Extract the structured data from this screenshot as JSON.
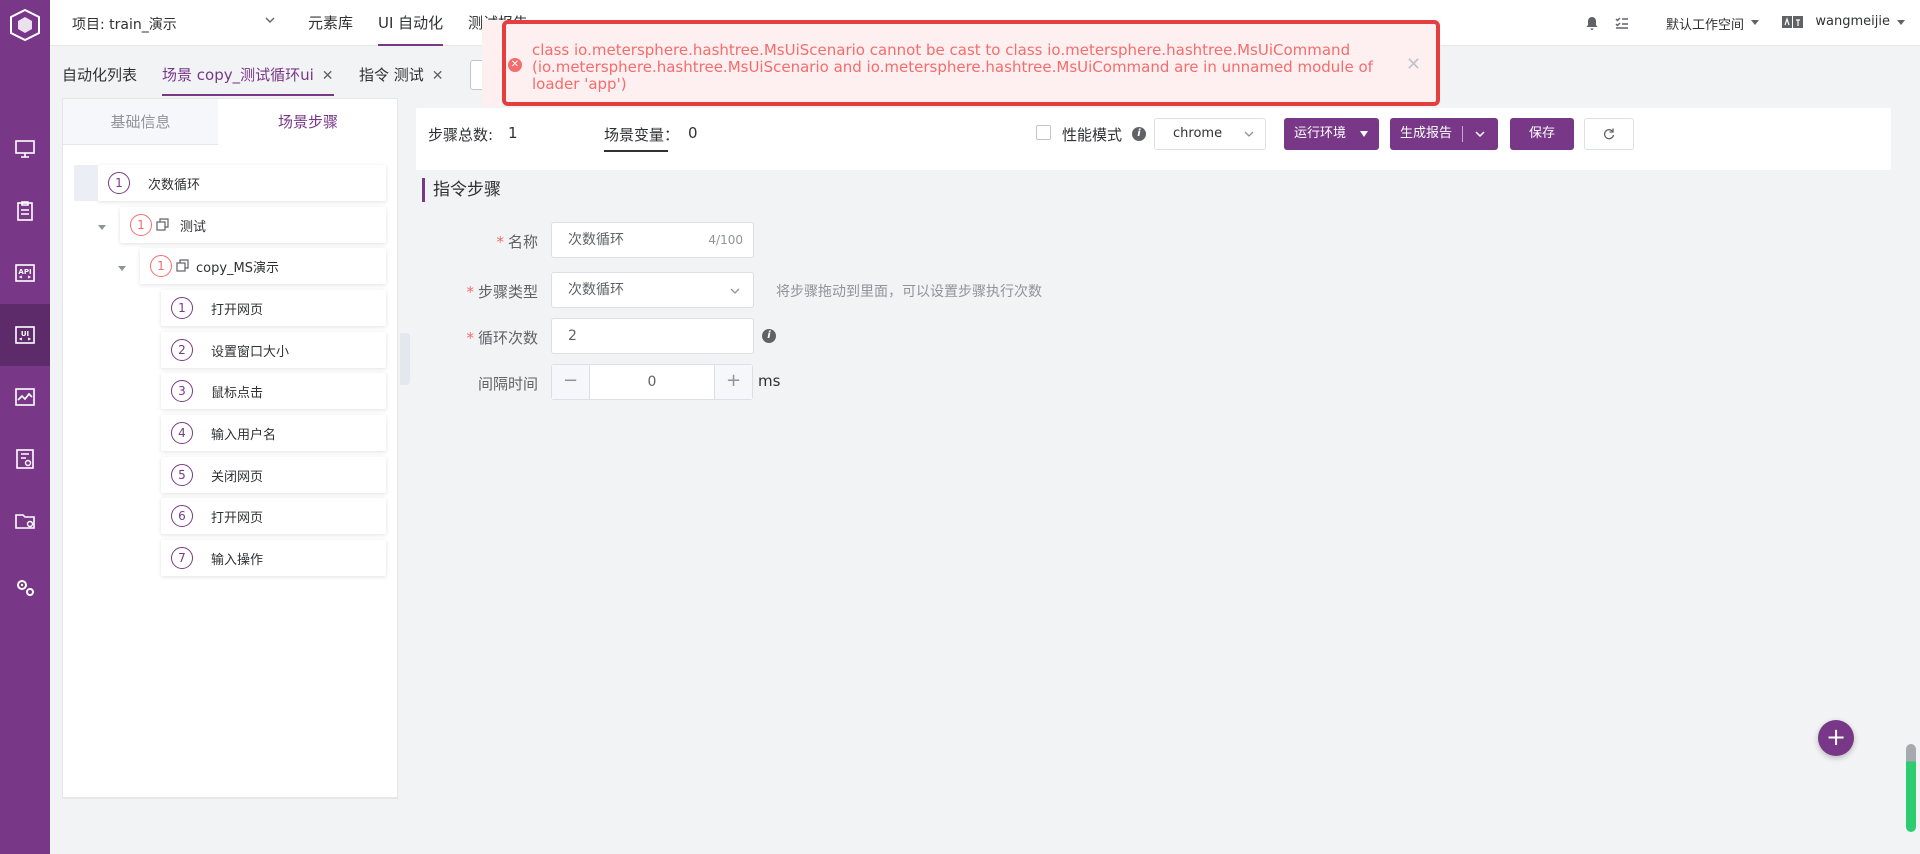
{
  "header": {
    "project": "项目: train_演示",
    "menu": [
      {
        "label": "元素库"
      },
      {
        "label": "UI 自动化"
      },
      {
        "label": "测试报告"
      }
    ],
    "workspace": "默认工作空间",
    "user": "wangmeijie"
  },
  "tabs": [
    {
      "label": "自动化列表"
    },
    {
      "label": "场景 copy_测试循环ui"
    },
    {
      "label": "指令 测试"
    }
  ],
  "side_panel": {
    "tab_basic": "基础信息",
    "tab_steps": "场景步骤",
    "tree": [
      {
        "num": "1",
        "label": "次数循环"
      },
      {
        "num": "1",
        "label": "测试"
      },
      {
        "num": "1",
        "label": "copy_MS演示"
      },
      {
        "num": "1",
        "label": "打开网页"
      },
      {
        "num": "2",
        "label": "设置窗口大小"
      },
      {
        "num": "3",
        "label": "鼠标点击"
      },
      {
        "num": "4",
        "label": "输入用户名"
      },
      {
        "num": "5",
        "label": "关闭网页"
      },
      {
        "num": "6",
        "label": "打开网页"
      },
      {
        "num": "7",
        "label": "输入操作"
      }
    ]
  },
  "toolbar": {
    "step_total_label": "步骤总数:",
    "step_total_value": "1",
    "scene_var_label": "场景变量：",
    "scene_var_value": "0",
    "perf_mode": "性能模式",
    "browser": "chrome",
    "run_env": "运行环境",
    "gen_report": "生成报告",
    "save": "保存"
  },
  "form": {
    "section_title": "指令步骤",
    "name_label": "名称",
    "name_value": "次数循环",
    "name_counter": "4/100",
    "type_label": "步骤类型",
    "type_value": "次数循环",
    "type_hint": "将步骤拖动到里面，可以设置步骤执行次数",
    "loop_label": "循环次数",
    "loop_value": "2",
    "interval_label": "间隔时间",
    "interval_value": "0",
    "interval_unit": "ms"
  },
  "notification": {
    "message": "class io.metersphere.hashtree.MsUiScenario cannot be cast to class io.metersphere.hashtree.MsUiCommand (io.metersphere.hashtree.MsUiScenario and io.metersphere.hashtree.MsUiCommand are in unnamed module of loader 'app')"
  },
  "colors": {
    "brand": "#783887",
    "error": "#f56c6c"
  }
}
